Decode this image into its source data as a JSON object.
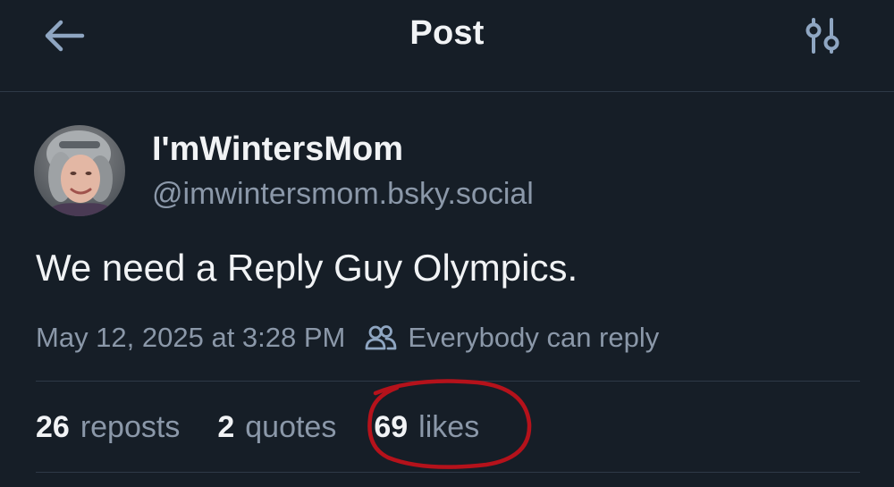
{
  "header": {
    "title": "Post",
    "back_icon": "arrow-left-icon",
    "settings_icon": "sliders-icon"
  },
  "author": {
    "display_name": "I'mWintersMom",
    "handle": "@imwintersmom.bsky.social"
  },
  "post": {
    "text": "We need a Reply Guy Olympics.",
    "timestamp": "May 12, 2025 at 3:28 PM",
    "reply_setting": "Everybody can reply",
    "reply_setting_icon": "people-icon"
  },
  "stats": {
    "reposts_count": "26",
    "reposts_label": "reposts",
    "quotes_count": "2",
    "quotes_label": "quotes",
    "likes_count": "69",
    "likes_label": "likes"
  },
  "colors": {
    "background": "#161e27",
    "primary_text": "#f1f3f5",
    "secondary_text": "#8b98a9",
    "icon": "#8fa6c2",
    "divider": "#2e3947",
    "annotation": "#b5121b"
  }
}
